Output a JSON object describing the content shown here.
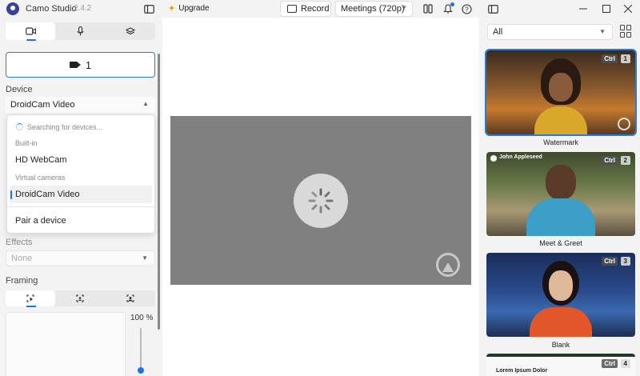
{
  "app": {
    "name": "Camo Studio",
    "version": "2.4.2"
  },
  "titlebar": {
    "upgrade_label": "Upgrade",
    "record_label": "Record",
    "meetings_label": "Meetings (720p)"
  },
  "left": {
    "source_count": "1",
    "device_label": "Device",
    "device_value": "DroidCam Video",
    "effects_label": "Effects",
    "effects_value": "None",
    "framing_label": "Framing",
    "zoom_value": "100 %",
    "dropdown": {
      "searching": "Searching for devices...",
      "group_builtin": "Built-in",
      "item_webcam": "HD WebCam",
      "group_virtual": "Virtual cameras",
      "item_droidcam": "DroidCam Video",
      "pair": "Pair a device"
    }
  },
  "right": {
    "filter_value": "All",
    "scenes": [
      {
        "caption": "Watermark",
        "ctrl": "Ctrl",
        "num": "1"
      },
      {
        "caption": "Meet & Greet",
        "ctrl": "Ctrl",
        "num": "2",
        "overlay_name": "John Appleseed"
      },
      {
        "caption": "Blank",
        "ctrl": "Ctrl",
        "num": "3"
      },
      {
        "caption": "",
        "ctrl": "Ctrl",
        "num": "4",
        "overlay_title": "Lorem Ipsum Dolor"
      }
    ]
  },
  "colors": {
    "accent": "#2b7bd6",
    "preview_bg": "#808080"
  }
}
